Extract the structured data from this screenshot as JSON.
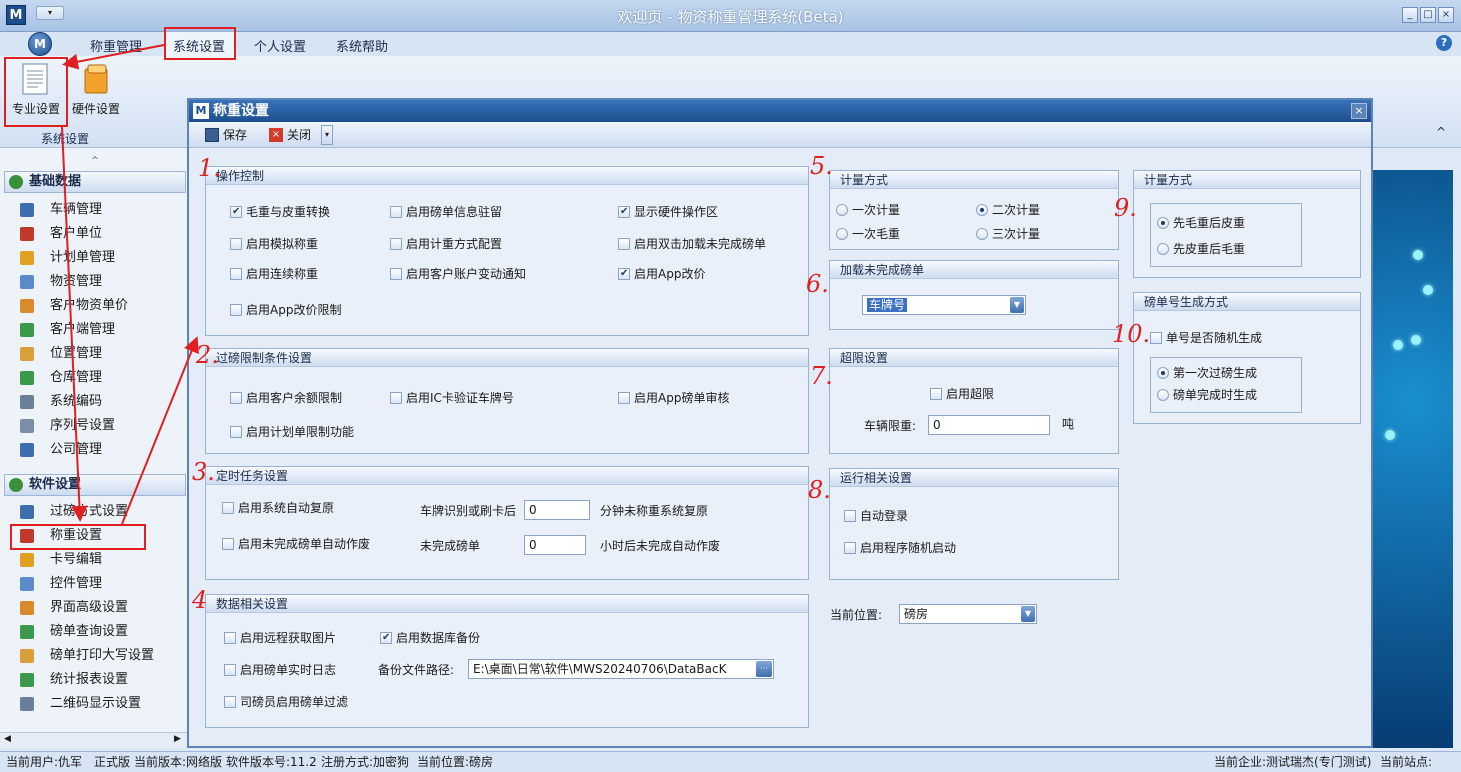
{
  "app": {
    "logo": "M",
    "title": "欢迎页 - 物资称重管理系统(Beta)",
    "qa_arrow": "▾",
    "window_buttons": [
      "_",
      "□",
      "×"
    ]
  },
  "menubar": {
    "orb": "M",
    "items": [
      "称重管理",
      "系统设置",
      "个人设置",
      "系统帮助"
    ],
    "help": "?"
  },
  "ribbon": {
    "buttons": [
      {
        "label": "专业设置",
        "icon": "document-icon"
      },
      {
        "label": "硬件设置",
        "icon": "cube-icon"
      }
    ],
    "group_label": "系统设置",
    "collapse": "^"
  },
  "sidebar": {
    "collapse_glyph": "^",
    "group1": {
      "title": "基础数据",
      "items": [
        "车辆管理",
        "客户单位",
        "计划单管理",
        "物资管理",
        "客户物资单价",
        "客户端管理",
        "位置管理",
        "仓库管理",
        "系统编码",
        "序列号设置",
        "公司管理"
      ]
    },
    "group2": {
      "title": "软件设置",
      "items": [
        "过磅方式设置",
        "称重设置",
        "卡号编辑",
        "控件管理",
        "界面高级设置",
        "磅单查询设置",
        "磅单打印大写设置",
        "统计报表设置",
        "二维码显示设置"
      ]
    }
  },
  "statusbar": {
    "left": [
      "当前用户:仇军",
      "正式版",
      "当前版本:网络版",
      "软件版本号:11.2",
      "注册方式:加密狗",
      "当前位置:磅房"
    ],
    "right": [
      "当前企业:测试瑞杰(专门测试)",
      "当前站点:"
    ]
  },
  "dialog": {
    "logo": "M",
    "title": "称重设置",
    "close": "×",
    "toolbar": {
      "save": "保存",
      "close": "关闭"
    },
    "op_control": {
      "title": "操作控制",
      "checks": [
        {
          "label": "毛重与皮重转换",
          "checked": true
        },
        {
          "label": "启用磅单信息驻留",
          "checked": false
        },
        {
          "label": "显示硬件操作区",
          "checked": true
        },
        {
          "label": "启用模拟称重",
          "checked": false
        },
        {
          "label": "启用计重方式配置",
          "checked": false
        },
        {
          "label": "启用双击加载未完成磅单",
          "checked": false
        },
        {
          "label": "启用连续称重",
          "checked": false
        },
        {
          "label": "启用客户账户变动通知",
          "checked": false
        },
        {
          "label": "启用App改价",
          "checked": true
        },
        {
          "label": "启用App改价限制",
          "checked": false
        }
      ]
    },
    "limit": {
      "title": "过磅限制条件设置",
      "checks": [
        {
          "label": "启用客户余额限制",
          "checked": false
        },
        {
          "label": "启用IC卡验证车牌号",
          "checked": false
        },
        {
          "label": "启用App磅单审核",
          "checked": false
        },
        {
          "label": "启用计划单限制功能",
          "checked": false
        }
      ]
    },
    "timer": {
      "title": "定时任务设置",
      "auto_reset": {
        "label": "启用系统自动复原",
        "checked": false
      },
      "auto_void": {
        "label": "启用未完成磅单自动作废",
        "checked": false
      },
      "plate_label": "车牌识别或刷卡后",
      "plate_value": "0",
      "plate_suffix": "分钟未称重系统复原",
      "unfinished_label": "未完成磅单",
      "unfinished_value": "0",
      "unfinished_suffix": "小时后未完成自动作废"
    },
    "data": {
      "title": "数据相关设置",
      "checks": [
        {
          "label": "启用远程获取图片",
          "checked": false
        },
        {
          "label": "启用数据库备份",
          "checked": true
        },
        {
          "label": "启用磅单实时日志",
          "checked": false
        },
        {
          "label": "司磅员启用磅单过滤",
          "checked": false
        }
      ],
      "backup_label": "备份文件路径:",
      "backup_path": "E:\\桌面\\日常\\软件\\MWS20240706\\DataBacK",
      "browse": "···"
    },
    "measure": {
      "title": "计量方式",
      "options": [
        {
          "label": "一次计量",
          "selected": false
        },
        {
          "label": "二次计量",
          "selected": true
        },
        {
          "label": "一次毛重",
          "selected": false
        },
        {
          "label": "三次计量",
          "selected": false
        }
      ]
    },
    "load_unfinished": {
      "title": "加载未完成磅单",
      "value": "车牌号",
      "arrow": "▼"
    },
    "overlimit": {
      "title": "超限设置",
      "enable": {
        "label": "启用超限",
        "checked": false
      },
      "limit_label": "车辆限重:",
      "limit_value": "0",
      "unit": "吨"
    },
    "run": {
      "title": "运行相关设置",
      "checks": [
        {
          "label": "自动登录",
          "checked": false
        },
        {
          "label": "启用程序随机启动",
          "checked": false
        }
      ]
    },
    "position": {
      "label": "当前位置:",
      "value": "磅房",
      "arrow": "▼"
    },
    "measure2": {
      "title": "计量方式",
      "options": [
        {
          "label": "先毛重后皮重",
          "selected": true
        },
        {
          "label": "先皮重后毛重",
          "selected": false
        }
      ]
    },
    "ticket_no": {
      "title": "磅单号生成方式",
      "random": {
        "label": "单号是否随机生成",
        "checked": false
      },
      "options": [
        {
          "label": "第一次过磅生成",
          "selected": true
        },
        {
          "label": "磅单完成时生成",
          "selected": false
        }
      ]
    }
  },
  "annotations": [
    "1.",
    "2.",
    "3.",
    "4",
    "5.",
    "6.",
    "7.",
    "8.",
    "9.",
    "10."
  ],
  "colors": {
    "annotation": "#e02020",
    "title_bar": "#1c4e8e",
    "panel_bg": "#e4ecf7"
  }
}
